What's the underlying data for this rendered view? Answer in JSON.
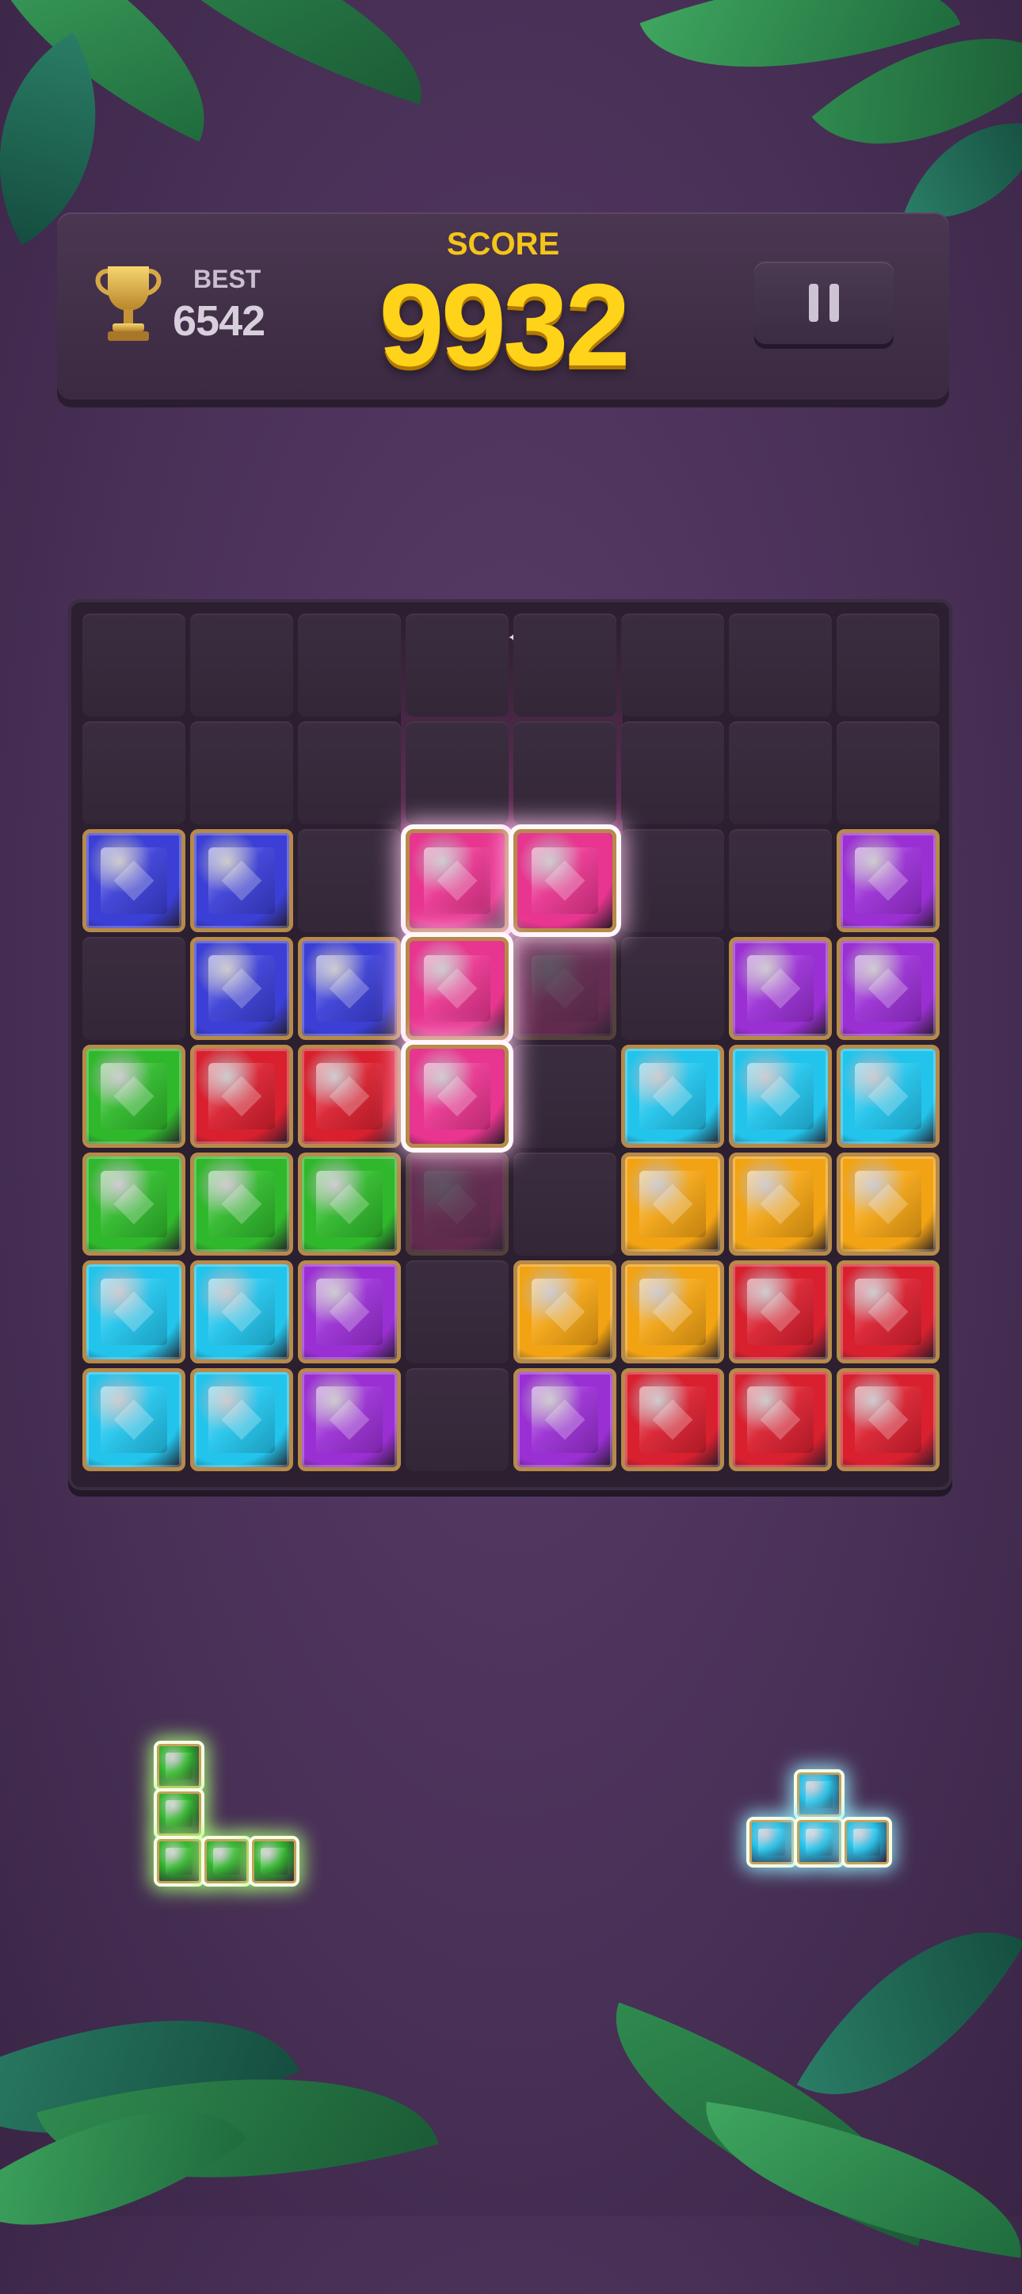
{
  "header": {
    "best_label": "BEST",
    "best_value": "6542",
    "score_label": "SCORE",
    "score_value": "9932"
  },
  "colors": {
    "blue": "#3b3fd6",
    "purple": "#9a2fd4",
    "green": "#2fb82b",
    "red": "#d9202f",
    "cyan": "#22c4ec",
    "orange": "#f2a313",
    "pink": "#e8358f",
    "accent_score": "#ffd31a",
    "gem_frame": "#b78a4a"
  },
  "board": {
    "rows": 8,
    "cols": 8,
    "grid": [
      [
        "",
        "",
        "",
        "",
        "",
        "",
        "",
        ""
      ],
      [
        "",
        "",
        "",
        "",
        "",
        "",
        "",
        ""
      ],
      [
        "blue",
        "blue",
        "",
        "",
        "",
        "",
        "",
        "purple"
      ],
      [
        "",
        "blue",
        "blue",
        "",
        "",
        "",
        "purple",
        "purple"
      ],
      [
        "green",
        "red",
        "red",
        "",
        "",
        "cyan",
        "cyan",
        "cyan"
      ],
      [
        "green",
        "green",
        "green",
        "",
        "",
        "orange",
        "orange",
        "orange"
      ],
      [
        "cyan",
        "cyan",
        "purple",
        "",
        "orange",
        "orange",
        "red",
        "red"
      ],
      [
        "cyan",
        "cyan",
        "purple",
        "",
        "purple",
        "red",
        "red",
        "red"
      ]
    ],
    "ghost_cells": [
      [
        3,
        4
      ],
      [
        5,
        3
      ]
    ],
    "active_piece": {
      "color": "pink",
      "cells": [
        [
          2,
          3
        ],
        [
          2,
          4
        ],
        [
          3,
          3
        ],
        [
          4,
          3
        ]
      ]
    }
  },
  "tray": [
    {
      "name": "l-piece",
      "color": "green",
      "cells": [
        [
          0,
          0
        ],
        [
          1,
          0
        ],
        [
          2,
          0
        ],
        [
          2,
          1
        ],
        [
          2,
          2
        ]
      ]
    },
    {
      "name": "t-piece",
      "color": "cyan",
      "cells": [
        [
          0,
          1
        ],
        [
          1,
          0
        ],
        [
          1,
          1
        ],
        [
          1,
          2
        ]
      ]
    }
  ],
  "icons": {
    "trophy": "trophy-icon",
    "pause": "pause-icon"
  }
}
